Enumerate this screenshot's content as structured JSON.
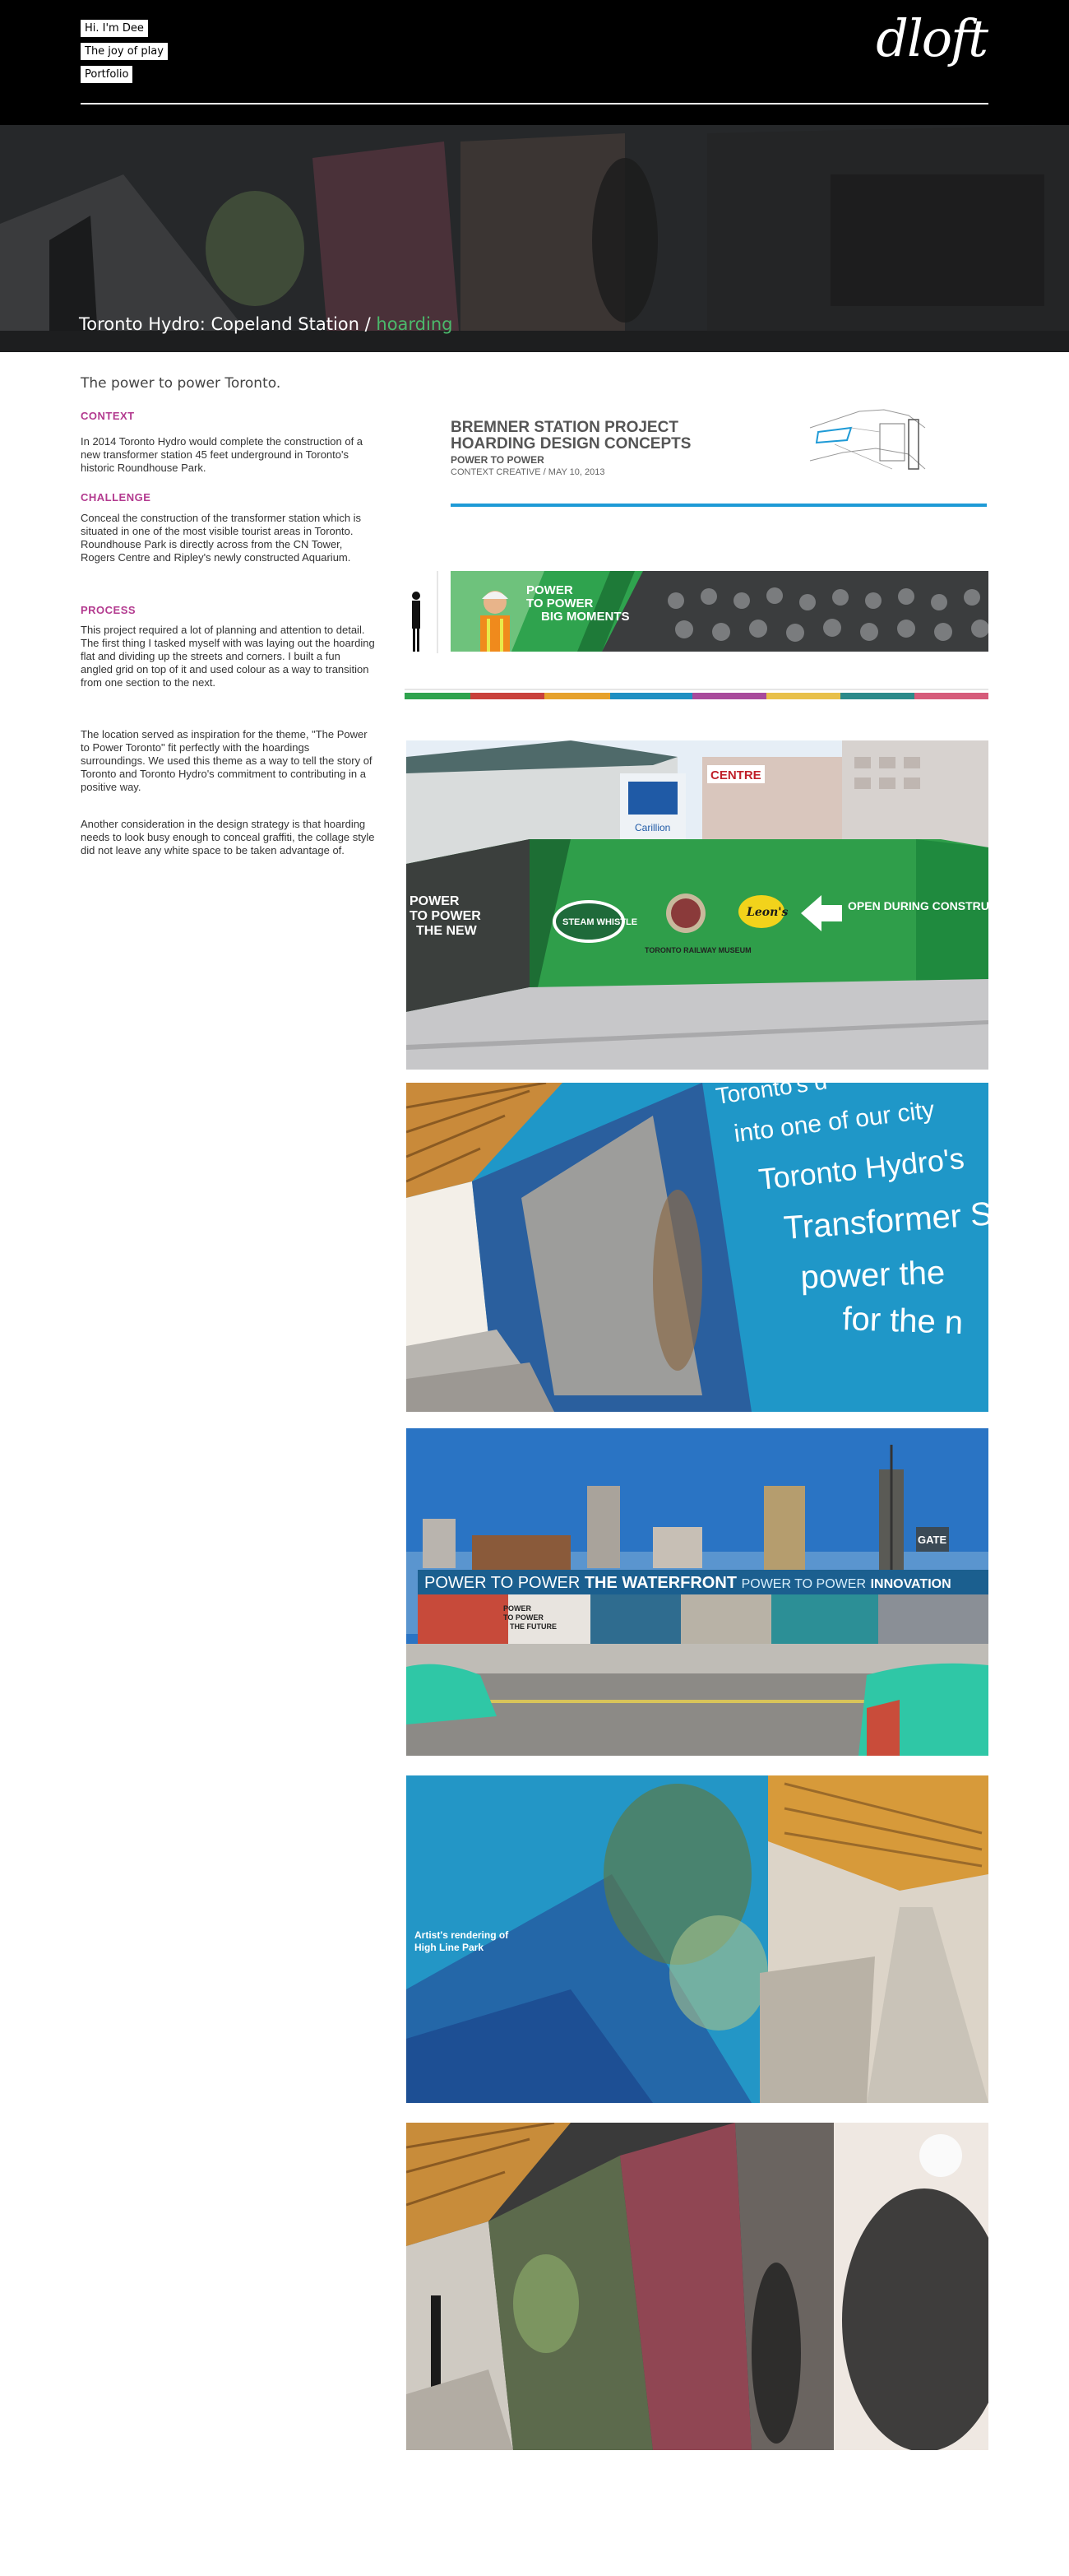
{
  "nav": {
    "items": [
      "Hi. I'm Dee",
      "The joy of play",
      "Portfolio"
    ]
  },
  "logo": {
    "text": "dloft"
  },
  "hero": {
    "title": "Toronto Hydro: Copeland Station",
    "separator": " / ",
    "tag": "hoarding"
  },
  "intro": "The power to power Toronto.",
  "sections": [
    {
      "heading": "CONTEXT",
      "body": "In 2014 Toronto Hydro would complete the construction of a new transformer station 45 feet underground in Toronto's historic Roundhouse Park."
    },
    {
      "heading": "CHALLENGE",
      "body": "Conceal the construction of the transformer station which is situated in one of the most visible tourist areas in Toronto. Roundhouse Park is directly across from the CN Tower, Rogers Centre and Ripley's newly constructed Aquarium."
    },
    {
      "heading": "PROCESS",
      "body": "This project required a lot of planning and attention to detail. The first thing I tasked myself with was laying out the hoarding flat and dividing up the streets and corners. I built a fun angled grid on top of it and used colour as a way to transition from one section to the next."
    },
    {
      "heading": "",
      "body": "The location served as inspiration for the theme, \"The Power to Power Toronto\" fit perfectly with the hoardings surroundings. We used this theme as a way to tell the story of Toronto and Toronto Hydro's commitment to contributing in a positive way."
    },
    {
      "heading": "",
      "body": "Another consideration in the design strategy is that hoarding needs to look busy enough to conceal graffiti, the collage style did not leave any white space to be taken advantage of."
    }
  ],
  "concept": {
    "title_line1": "BREMNER STATION PROJECT",
    "title_line2": "HOARDING DESIGN CONCEPTS",
    "subtitle": "POWER TO POWER",
    "credit": "CONTEXT CREATIVE / MAY 10, 2013"
  },
  "strip": {
    "headline_line1": "POWER",
    "headline_line2": "TO POWER",
    "headline_line3": "BIG MOMENTS"
  },
  "photo1": {
    "left_text_1": "POWER",
    "left_text_2": "TO POWER",
    "left_text_3": "THE NEW",
    "logo1": "STEAM WHISTLE",
    "logo2": "TORONTO RAILWAY MUSEUM",
    "logo3": "Leon's",
    "sign": "OPEN DURING CONSTRUCTION",
    "building_sign": "CENTRE",
    "building_logo": "Carillion"
  },
  "photo2": {
    "line1": "Toronto's d",
    "line2": "into one of our city",
    "line3": "Toronto Hydro's",
    "line4": "Transformer S",
    "line5": "power the",
    "line6": "for the n"
  },
  "photo3": {
    "banner_a": "POWER TO POWER",
    "banner_b": "THE WATERFRONT",
    "banner_c": "POWER TO POWER",
    "banner_d": "INNOVATION",
    "panel_1": "POWER",
    "panel_2": "TO POWER",
    "panel_3": "THE FUTURE",
    "gate": "GATE"
  },
  "photo4": {
    "caption_1": "Artist's rendering of",
    "caption_2": "High Line Park"
  },
  "colors": {
    "accent_heading": "#b33a8f",
    "hero_tag": "#4bb96b",
    "concept_bar": "#1e9ad6",
    "hoarding_green": "#2f9e4a",
    "hoarding_blue": "#1e8fc2"
  }
}
